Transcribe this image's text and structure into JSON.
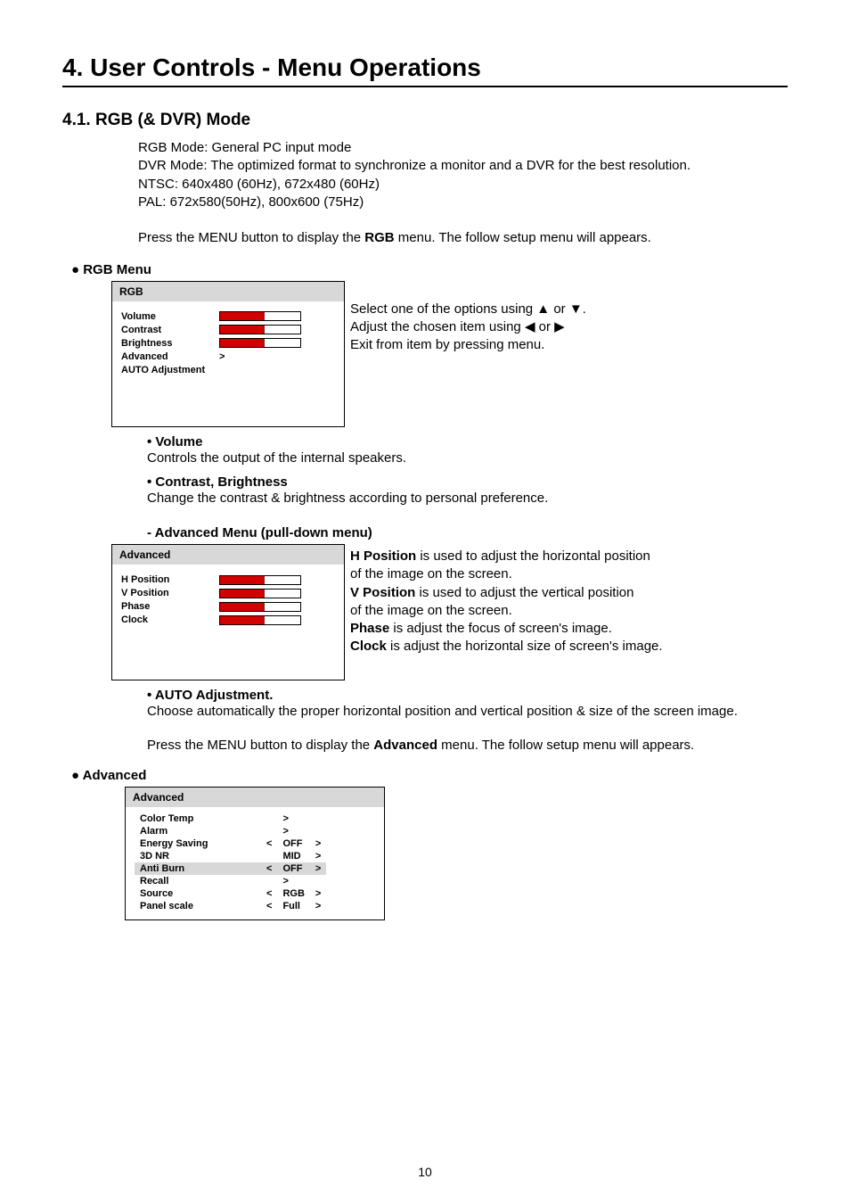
{
  "title": "4. User Controls - Menu Operations",
  "sub": "4.1. RGB (& DVR) Mode",
  "intro": {
    "l1": "RGB Mode: General PC input mode",
    "l2": "DVR Mode: The optimized format to synchronize a monitor and a DVR for the best resolution.",
    "l3": "NTSC: 640x480 (60Hz), 672x480 (60Hz)",
    "l4": " PAL: 672x580(50Hz), 800x600 (75Hz)",
    "l5a": "Press the MENU button to display the ",
    "l5b": "RGB",
    "l5c": " menu. The follow setup menu will appears."
  },
  "rgbMenuHead": "● RGB Menu",
  "osd1": {
    "title": "RGB",
    "r1": "Volume",
    "r2": "Contrast",
    "r3": "Brightness",
    "r4": "Advanced",
    "r4v": ">",
    "r5": "AUTO Adjustment"
  },
  "desc1": {
    "l1": "Select one of the options using ▲ or ▼.",
    "l2": "Adjust the chosen item using ◀ or ▶",
    "l3": "Exit from item by pressing menu."
  },
  "vol": {
    "h": "• Volume",
    "t": "Controls the output of the internal speakers."
  },
  "cb": {
    "h": "• Contrast, Brightness",
    "t": "Change the contrast & brightness according to personal preference."
  },
  "advHead": "- Advanced Menu (pull-down menu)",
  "osd2": {
    "title": "Advanced",
    "r1": "H Position",
    "r2": "V Position",
    "r3": "Phase",
    "r4": "Clock"
  },
  "desc2": {
    "hpb": "H Position",
    "hp": " is used to adjust the horizontal position",
    "hp2": "of the image on the screen.",
    "vpb": "V Position",
    "vp": " is used to adjust the vertical position",
    "vp2": "of the image on the screen.",
    "phb": "Phase",
    "ph": " is adjust the focus of screen's image.",
    "clb": "Clock",
    "cl": " is adjust the horizontal size of screen's image."
  },
  "auto": {
    "h": "• AUTO Adjustment.",
    "t": "Choose automatically the proper horizontal position and vertical position & size of the screen image."
  },
  "press2a": "Press the MENU button to display the ",
  "press2b": "Advanced",
  "press2c": " menu. The follow setup menu will appears.",
  "advancedHead": "● Advanced",
  "osd3": {
    "title": "Advanced",
    "r1": {
      "l": "Color Temp",
      "v": ">"
    },
    "r2": {
      "l": "Alarm",
      "v": ">"
    },
    "r3": {
      "l": "Energy Saving",
      "lt": "<",
      "v": "OFF",
      "gt": ">"
    },
    "r4": {
      "l": "3D NR",
      "lt": "",
      "v": "MID",
      "gt": ">"
    },
    "r5": {
      "l": "Anti Burn",
      "lt": "<",
      "v": "OFF",
      "gt": ">"
    },
    "r6": {
      "l": "Recall",
      "v": ">"
    },
    "r7": {
      "l": "Source",
      "lt": "<",
      "v": "RGB",
      "gt": ">"
    },
    "r8": {
      "l": "Panel scale",
      "lt": "<",
      "v": "Full",
      "gt": ">"
    }
  },
  "pageNum": "10"
}
